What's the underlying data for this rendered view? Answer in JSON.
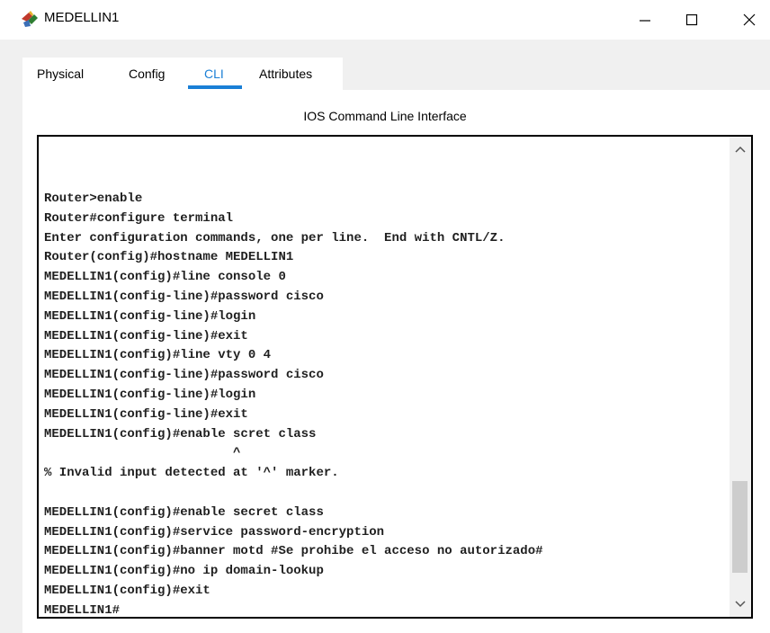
{
  "window": {
    "title": "MEDELLIN1",
    "icon": "router-device-icon",
    "controls": [
      "minimize",
      "maximize",
      "close"
    ]
  },
  "tabs": [
    {
      "label": "Physical",
      "selected": false
    },
    {
      "label": "Config",
      "selected": false
    },
    {
      "label": "CLI",
      "selected": true
    },
    {
      "label": "Attributes",
      "selected": false
    }
  ],
  "colors": {
    "accent": "#1a7fd6",
    "panel": "#f0f0f0",
    "text": "#202020"
  },
  "cli": {
    "heading": "IOS Command Line Interface",
    "output": "Router>enable\nRouter#configure terminal\nEnter configuration commands, one per line.  End with CNTL/Z.\nRouter(config)#hostname MEDELLIN1\nMEDELLIN1(config)#line console 0\nMEDELLIN1(config-line)#password cisco\nMEDELLIN1(config-line)#login\nMEDELLIN1(config-line)#exit\nMEDELLIN1(config)#line vty 0 4\nMEDELLIN1(config-line)#password cisco\nMEDELLIN1(config-line)#login\nMEDELLIN1(config-line)#exit\nMEDELLIN1(config)#enable scret class\n                         ^\n% Invalid input detected at '^' marker.\n\nMEDELLIN1(config)#enable secret class\nMEDELLIN1(config)#service password-encryption\nMEDELLIN1(config)#banner motd #Se prohibe el acceso no autorizado#\nMEDELLIN1(config)#no ip domain-lookup\nMEDELLIN1(config)#exit\nMEDELLIN1#"
  }
}
